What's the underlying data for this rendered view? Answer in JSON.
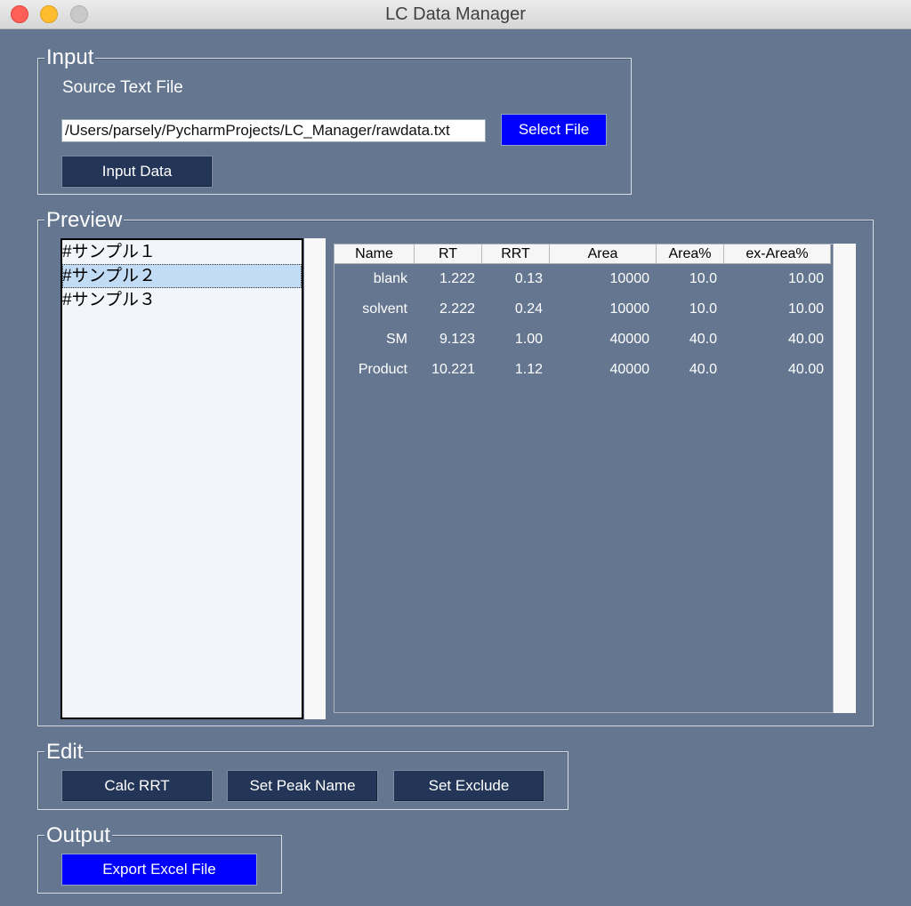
{
  "window": {
    "title": "LC Data Manager"
  },
  "input": {
    "label": "Input",
    "source_label": "Source Text File",
    "path_value": "/Users/parsely/PycharmProjects/LC_Manager/rawdata.txt",
    "select_button": "Select File",
    "input_button": "Input Data"
  },
  "preview": {
    "label": "Preview",
    "samples": [
      "#サンプル１",
      "#サンプル２",
      "#サンプル３"
    ],
    "selected_index": 1,
    "columns": [
      "Name",
      "RT",
      "RRT",
      "Area",
      "Area%",
      "ex-Area%"
    ],
    "rows": [
      [
        "blank",
        "1.222",
        "0.13",
        "10000",
        "10.0",
        "10.00"
      ],
      [
        "solvent",
        "2.222",
        "0.24",
        "10000",
        "10.0",
        "10.00"
      ],
      [
        "SM",
        "9.123",
        "1.00",
        "40000",
        "40.0",
        "40.00"
      ],
      [
        "Product",
        "10.221",
        "1.12",
        "40000",
        "40.0",
        "40.00"
      ]
    ]
  },
  "edit": {
    "label": "Edit",
    "calc_button": "Calc RRT",
    "peak_button": "Set Peak Name",
    "exclude_button": "Set Exclude"
  },
  "output": {
    "label": "Output",
    "export_button": "Export Excel File"
  },
  "colors": {
    "background": "#657790",
    "button_dark": "#243657",
    "button_accent": "#0000ff",
    "selection": "#c2dcf6"
  }
}
